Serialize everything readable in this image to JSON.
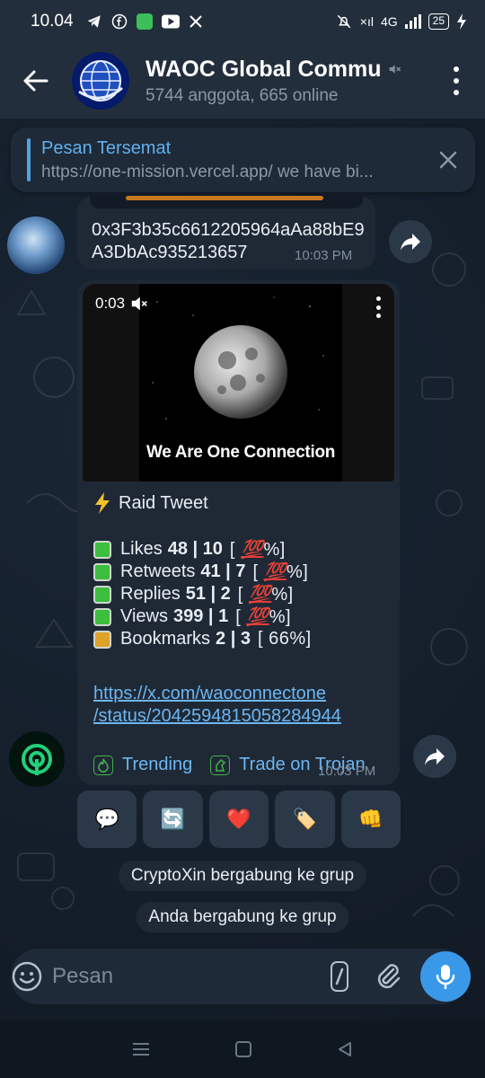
{
  "status_bar": {
    "time": "10.04",
    "network": "4G",
    "battery": "25"
  },
  "header": {
    "title": "WAOC Global Commu",
    "subtitle": "5744 anggota, 665 online"
  },
  "pinned": {
    "title": "Pesan Tersemat",
    "snippet": "https://one-mission.vercel.app/ we have bi..."
  },
  "messages": [
    {
      "text": "0x3F3b35c6612205964aAa88bE9A3DbAc935213657",
      "time": "10:03 PM"
    },
    {
      "video_duration": "0:03",
      "video_caption": "We Are One Connection",
      "raid_title": "Raid Tweet",
      "stats": [
        {
          "label": "Likes",
          "nums": "48 | 10",
          "pct_open": "[",
          "pct_mark": "💯",
          "pct_close": "%]",
          "status": "green"
        },
        {
          "label": "Retweets",
          "nums": "41 | 7",
          "pct_open": "[",
          "pct_mark": "💯",
          "pct_close": "%]",
          "status": "green"
        },
        {
          "label": "Replies",
          "nums": "51 | 2",
          "pct_open": "[",
          "pct_mark": "💯",
          "pct_close": "%]",
          "status": "green"
        },
        {
          "label": "Views",
          "nums": "399 | 1",
          "pct_open": "[",
          "pct_mark": "💯",
          "pct_close": "%]",
          "status": "green"
        },
        {
          "label": "Bookmarks",
          "nums": "2 | 3",
          "pct_open": "[",
          "pct_mark": "66",
          "pct_close": "%]",
          "status": "orange"
        }
      ],
      "link_line1": "https://x.com/waoconnectone",
      "link_line2": "/status/2042594815058284944",
      "footer_link1": "Trending",
      "footer_link2": "Trade on Trojan",
      "time": "10:03 PM"
    }
  ],
  "reactions": [
    "💬",
    "🔄",
    "❤️",
    "🏷️",
    "👊"
  ],
  "service_messages": [
    "CryptoXin bergabung ke grup",
    "Anda bergabung ke grup"
  ],
  "input": {
    "placeholder": "Pesan"
  },
  "colors": {
    "accent": "#3a98e8",
    "link": "#6cb6f2",
    "header_bg": "#232e3c",
    "bubble_bg": "#1f2936"
  }
}
